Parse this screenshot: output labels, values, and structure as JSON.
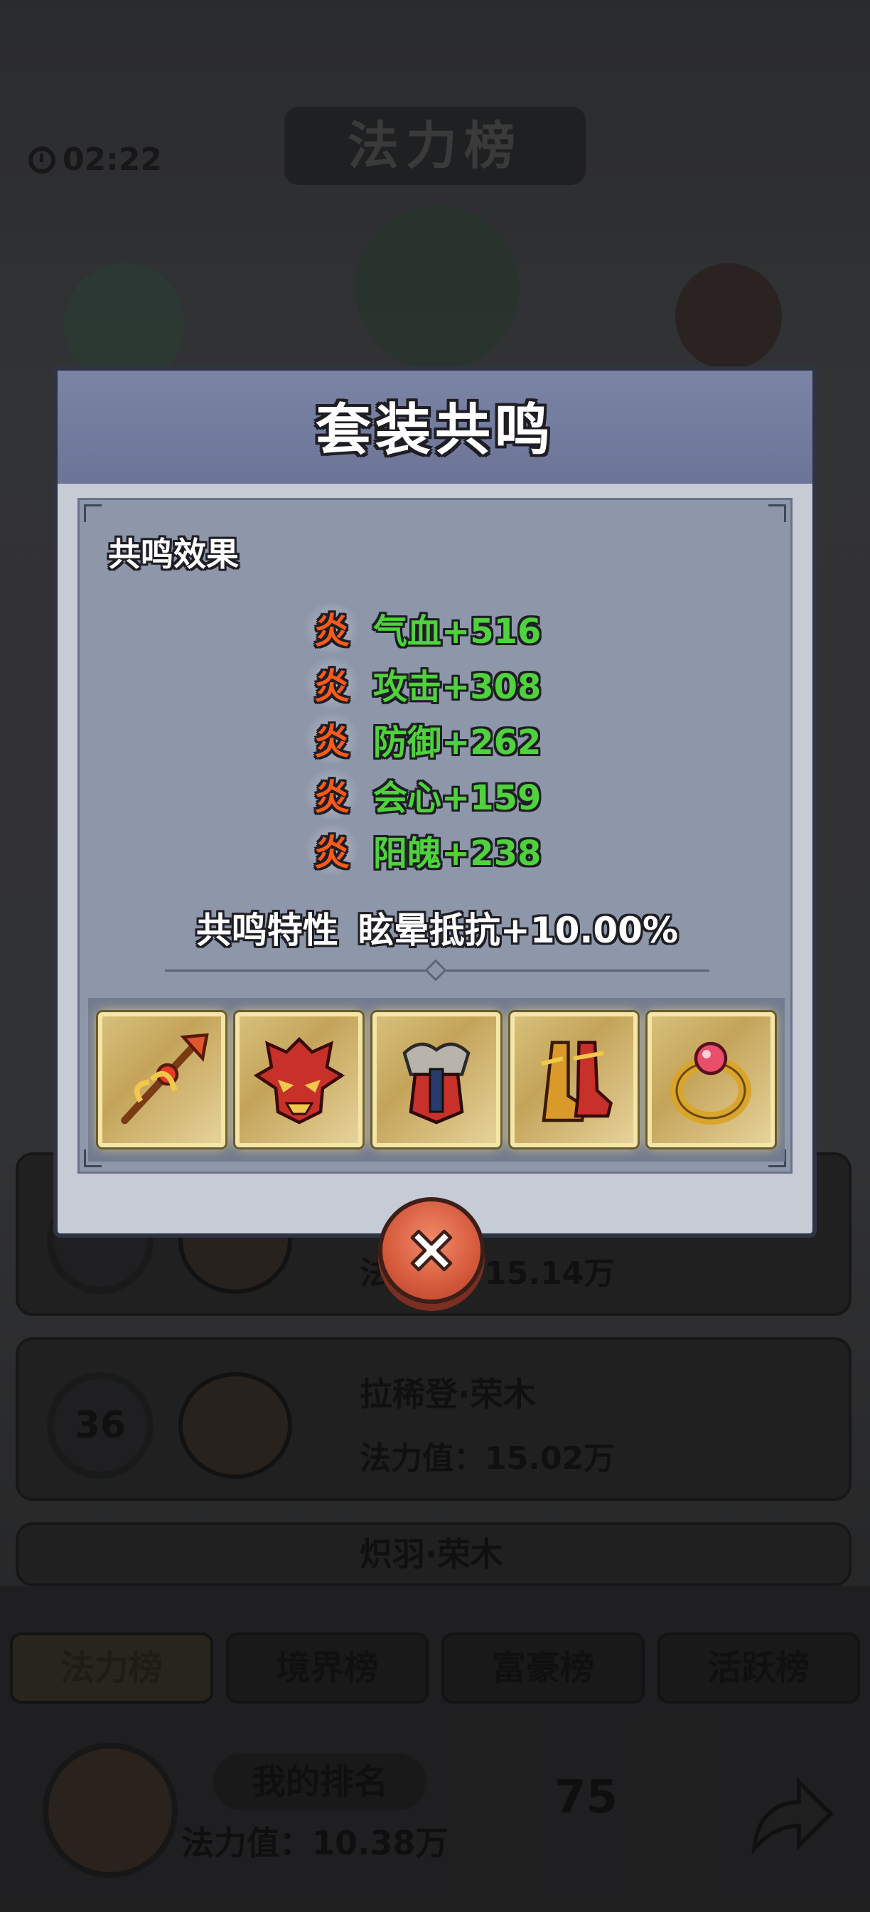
{
  "background": {
    "timer": "02:22",
    "board_title": "法力榜",
    "rank_cards": [
      {
        "rank": "",
        "name": "",
        "power": "法力值：15.14万"
      },
      {
        "rank": "36",
        "name": "拉稀登·荣木",
        "power": "法力值：15.02万"
      },
      {
        "rank": "",
        "name": "炽羽·荣木",
        "power": ""
      }
    ],
    "tabs": [
      "法力榜",
      "境界榜",
      "富豪榜",
      "活跃榜"
    ],
    "my_rank_label": "我的排名",
    "my_power": "法力值：10.38万",
    "my_rank_number": "75"
  },
  "dialog": {
    "title": "套装共鸣",
    "section_title": "共鸣效果",
    "stat_icon_glyph": "炎",
    "stats": [
      {
        "text": "气血+516"
      },
      {
        "text": "攻击+308"
      },
      {
        "text": "防御+262"
      },
      {
        "text": "会心+159"
      },
      {
        "text": "阳魄+238"
      }
    ],
    "trait_label": "共鸣特性",
    "trait_value": "眩晕抵抗+10.00%",
    "equipment": [
      {
        "icon": "staff-weapon-icon"
      },
      {
        "icon": "demon-mask-icon"
      },
      {
        "icon": "armor-icon"
      },
      {
        "icon": "boots-icon"
      },
      {
        "icon": "ring-icon"
      }
    ]
  },
  "colors": {
    "stat_green": "#4fd23d",
    "fire_orange": "#ff5a1a",
    "header_blue": "#7c84a6",
    "close_red": "#d65a3c"
  }
}
